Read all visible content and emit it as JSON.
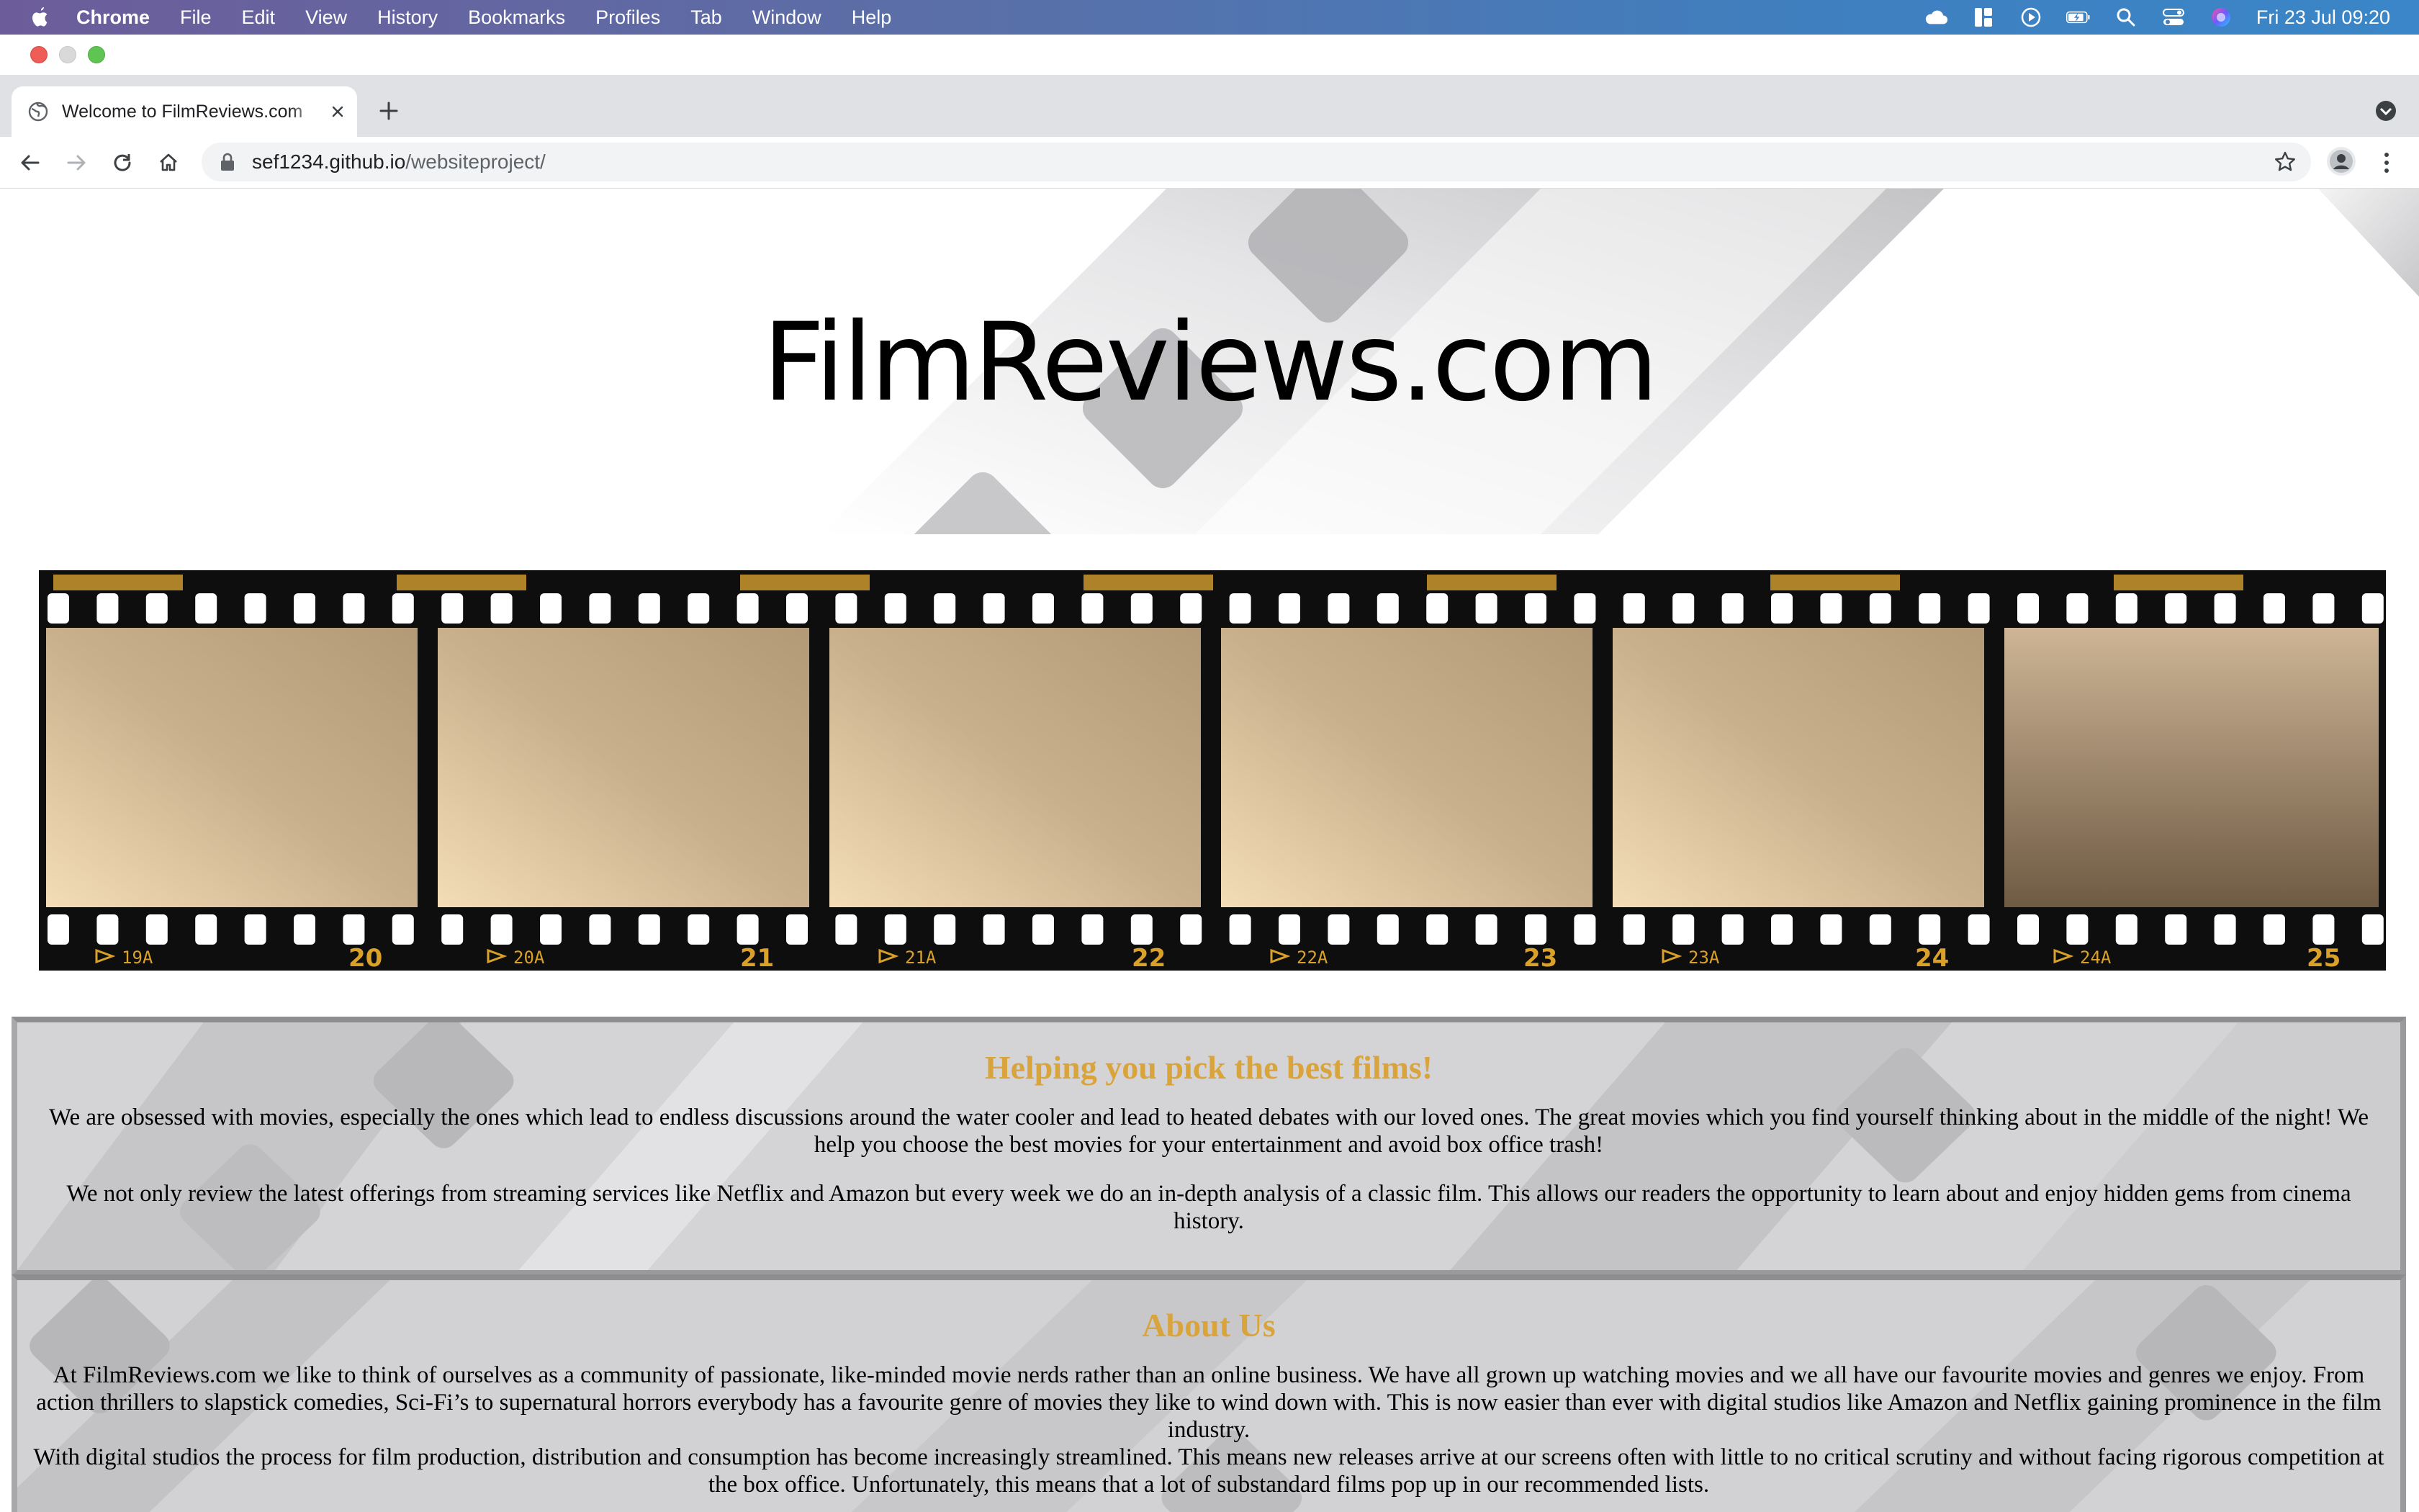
{
  "menubar": {
    "app_name": "Chrome",
    "items": [
      "File",
      "Edit",
      "View",
      "History",
      "Bookmarks",
      "Profiles",
      "Tab",
      "Window",
      "Help"
    ],
    "clock": "Fri 23 Jul  09:20"
  },
  "browser": {
    "tab_title": "Welcome to FilmReviews.com",
    "url_host": "sef1234.github.io",
    "url_path": "/websiteproject/"
  },
  "page": {
    "site_title": "FilmReviews.com",
    "film_numbers_large": [
      "20",
      "21",
      "22",
      "23",
      "24",
      "25"
    ],
    "film_numbers_small": [
      "19A",
      "20A",
      "21A",
      "22A",
      "23A",
      "24A"
    ],
    "section1": {
      "heading": "Helping you pick the best films!",
      "p1": "We are obsessed with movies, especially the ones which lead to endless discussions around the water cooler and lead to heated debates with our loved ones. The great movies which you find yourself thinking about in the middle of the night! We help you choose the best movies for your entertainment and avoid box office trash!",
      "p2": "We not only review the latest offerings from streaming services like Netflix and Amazon but every week we do an in-depth analysis of a classic film. This allows our readers the opportunity to learn about and enjoy hidden gems from cinema history."
    },
    "section2": {
      "heading": "About Us",
      "p1": "At FilmReviews.com we like to think of ourselves as a community of passionate, like-minded movie nerds rather than an online business. We have all grown up watching movies and we all have our favourite movies and genres we enjoy. From action thrillers to slapstick comedies, Sci-Fi’s to supernatural horrors everybody has a favourite genre of movies they like to wind down with. This is now easier than ever with digital studios like Amazon and Netflix gaining prominence in the film industry.",
      "p2": "With digital studios the process for film production, distribution and consumption has become increasingly streamlined. This means new releases arrive at our screens often with little to no critical scrutiny and without facing rigorous competition at the box office. Unfortunately, this means that a lot of substandard films pop up in our recommended lists."
    }
  },
  "colors": {
    "heading_gold": "#d9a43c",
    "film_frame": "#c8b08c",
    "menubar_blue": "#3a86c8"
  }
}
